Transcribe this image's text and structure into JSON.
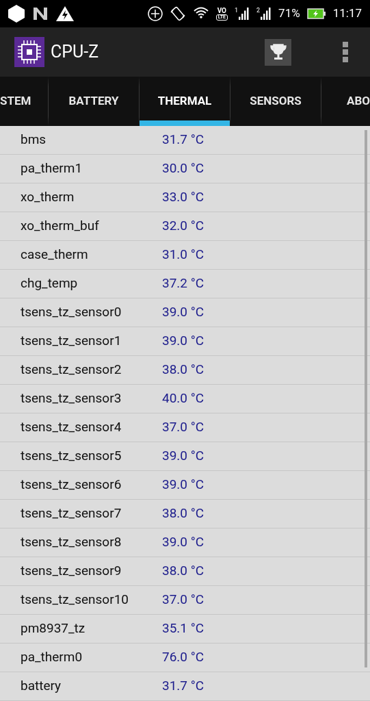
{
  "status_bar": {
    "volte": "VO",
    "lte": "LTE",
    "sim1": "1",
    "sim2": "2",
    "battery": "71%",
    "time": "11:17"
  },
  "app_bar": {
    "title": "CPU-Z"
  },
  "tabs": [
    {
      "label": "STEM",
      "selected": false
    },
    {
      "label": "BATTERY",
      "selected": false
    },
    {
      "label": "THERMAL",
      "selected": true
    },
    {
      "label": "SENSORS",
      "selected": false
    },
    {
      "label": "ABO",
      "selected": false
    }
  ],
  "sensors": [
    {
      "name": "bms",
      "value": "31.7 °C"
    },
    {
      "name": "pa_therm1",
      "value": "30.0 °C"
    },
    {
      "name": "xo_therm",
      "value": "33.0 °C"
    },
    {
      "name": "xo_therm_buf",
      "value": "32.0 °C"
    },
    {
      "name": "case_therm",
      "value": "31.0 °C"
    },
    {
      "name": "chg_temp",
      "value": "37.2 °C"
    },
    {
      "name": "tsens_tz_sensor0",
      "value": "39.0 °C"
    },
    {
      "name": "tsens_tz_sensor1",
      "value": "39.0 °C"
    },
    {
      "name": "tsens_tz_sensor2",
      "value": "38.0 °C"
    },
    {
      "name": "tsens_tz_sensor3",
      "value": "40.0 °C"
    },
    {
      "name": "tsens_tz_sensor4",
      "value": "37.0 °C"
    },
    {
      "name": "tsens_tz_sensor5",
      "value": "39.0 °C"
    },
    {
      "name": "tsens_tz_sensor6",
      "value": "39.0 °C"
    },
    {
      "name": "tsens_tz_sensor7",
      "value": "38.0 °C"
    },
    {
      "name": "tsens_tz_sensor8",
      "value": "39.0 °C"
    },
    {
      "name": "tsens_tz_sensor9",
      "value": "38.0 °C"
    },
    {
      "name": "tsens_tz_sensor10",
      "value": "37.0 °C"
    },
    {
      "name": "pm8937_tz",
      "value": "35.1 °C"
    },
    {
      "name": "pa_therm0",
      "value": "76.0 °C"
    },
    {
      "name": "battery",
      "value": "31.7 °C"
    }
  ]
}
